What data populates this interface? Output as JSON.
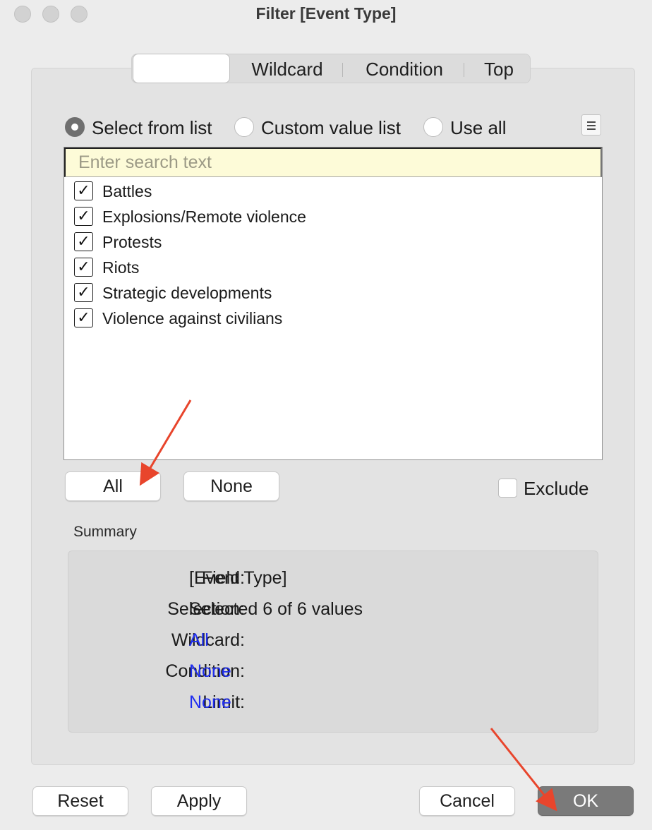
{
  "window": {
    "title": "Filter [Event Type]"
  },
  "tabs": [
    {
      "label": ""
    },
    {
      "label": "Wildcard"
    },
    {
      "label": "Condition"
    },
    {
      "label": "Top"
    }
  ],
  "mode_options": {
    "select_from_list": "Select from list",
    "custom_value_list": "Custom value list",
    "use_all": "Use all",
    "selected": "Select from list"
  },
  "search": {
    "placeholder": "Enter search text",
    "value": ""
  },
  "list": {
    "items": [
      {
        "label": "Battles",
        "checked": true
      },
      {
        "label": "Explosions/Remote violence",
        "checked": true
      },
      {
        "label": "Protests",
        "checked": true
      },
      {
        "label": "Riots",
        "checked": true
      },
      {
        "label": "Strategic developments",
        "checked": true
      },
      {
        "label": "Violence against civilians",
        "checked": true
      }
    ],
    "check_glyph": "✓"
  },
  "selection_buttons": {
    "all": "All",
    "none": "None"
  },
  "exclude": {
    "label": "Exclude",
    "checked": false
  },
  "summary": {
    "title": "Summary",
    "field_key": "Field:",
    "field_val": "[Event Type]",
    "selection_key": "Selection:",
    "selection_val": "Selected 6 of 6 values",
    "wildcard_key": "Wildcard:",
    "wildcard_val": "All",
    "condition_key": "Condition:",
    "condition_val": "None",
    "limit_key": "Limit:",
    "limit_val": "None",
    "link_color": "#1f2ef0"
  },
  "footer": {
    "reset": "Reset",
    "apply": "Apply",
    "cancel": "Cancel",
    "ok": "OK"
  },
  "annotation": {
    "arrow_color": "#e8452c"
  }
}
